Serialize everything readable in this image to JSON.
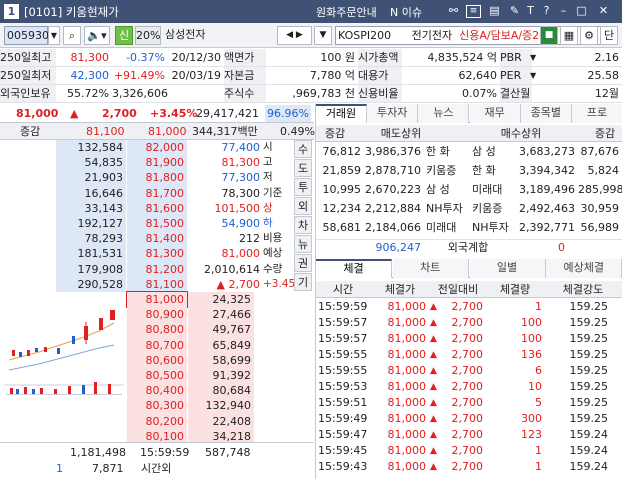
{
  "window": {
    "screen_no": "[0101]",
    "title": "키움현재가",
    "links": [
      "원화주문안내",
      "N 이슈"
    ]
  },
  "toolbar": {
    "code": "005930",
    "tag": "신",
    "pct": "20%",
    "stock_name": "삼성전자",
    "index": "KOSPI200",
    "sector": "전기전자",
    "credit": "신용A/담보A/증20",
    "right_btn": "단"
  },
  "info_rows": [
    {
      "a_label": "250일최고",
      "a_value": "81,300",
      "a_rate": "-0.37%",
      "a_date": "20/12/30",
      "b_label": "액면가",
      "b_value": "100 원",
      "c_label": "시가총액",
      "c_value": "4,835,524 억",
      "d_label": "PBR",
      "d_value": "2.16"
    },
    {
      "a_label": "250일최저",
      "a_value": "42,300",
      "a_rate": "+91.49%",
      "a_date": "20/03/19",
      "b_label": "자본금",
      "b_value": "7,780 억",
      "c_label": "대용가",
      "c_value": "62,640",
      "d_label": "PER",
      "d_value": "25.58"
    },
    {
      "a_label": "외국인보유",
      "a_value": "55.72%",
      "a_rate": "3,326,606(천)",
      "a_date": "",
      "b_label": "주식수",
      "b_value": ",969,783 천",
      "c_label": "신용비율",
      "c_value": "0.07%",
      "d_label": "결산월",
      "d_value": "12월"
    }
  ],
  "summary": {
    "price": "81,000",
    "arrow": "▲",
    "change": "2,700",
    "rate": "+3.45%",
    "volume": "29,417,421",
    "vol_ratio": "96.96%"
  },
  "ob_header": {
    "label": "증감",
    "price1": "81,100",
    "price2": "81,000",
    "amount": "344,317백만",
    "pct": "0.49%"
  },
  "ask_rows": [
    {
      "qty": "132,584",
      "price": "82,000"
    },
    {
      "qty": "54,835",
      "price": "81,900"
    },
    {
      "qty": "21,903",
      "price": "81,800"
    },
    {
      "qty": "16,646",
      "price": "81,700"
    },
    {
      "qty": "33,143",
      "price": "81,600"
    },
    {
      "qty": "192,127",
      "price": "81,500"
    },
    {
      "qty": "78,293",
      "price": "81,400"
    },
    {
      "qty": "181,531",
      "price": "81,300"
    },
    {
      "qty": "179,908",
      "price": "81,200"
    },
    {
      "qty": "290,528",
      "price": "81,100"
    }
  ],
  "bid_rows": [
    {
      "price": "81,000",
      "qty": "24,325"
    },
    {
      "price": "80,900",
      "qty": "27,466"
    },
    {
      "price": "80,800",
      "qty": "49,767"
    },
    {
      "price": "80,700",
      "qty": "65,849"
    },
    {
      "price": "80,600",
      "qty": "58,699"
    },
    {
      "price": "80,500",
      "qty": "91,392"
    },
    {
      "price": "80,400",
      "qty": "80,684"
    },
    {
      "price": "80,300",
      "qty": "132,940"
    },
    {
      "price": "80,200",
      "qty": "22,408"
    },
    {
      "price": "80,100",
      "qty": "34,218"
    }
  ],
  "mid_info": [
    {
      "v": "77,400",
      "l": "시"
    },
    {
      "v": "81,300",
      "l": "고"
    },
    {
      "v": "77,300",
      "l": "저"
    },
    {
      "v": "78,300",
      "l": "기준"
    },
    {
      "v": "101,500",
      "l": "상"
    },
    {
      "v": "54,900",
      "l": "하"
    },
    {
      "v": "212",
      "l": "비용"
    },
    {
      "v": "81,000",
      "l": "예상"
    },
    {
      "v": "2,010,614",
      "l": "수량"
    },
    {
      "v": "▲ 2,700",
      "l": "+3.45%"
    }
  ],
  "side_tabs": [
    "수",
    "도",
    "투",
    "외",
    "차",
    "뉴",
    "권",
    "기"
  ],
  "bottom": {
    "ask_total": "1,181,498",
    "time": "15:59:59",
    "bid_total": "587,748",
    "n1": "1",
    "n2": "7,871",
    "label": "시간외"
  },
  "top_tabs": [
    "거래원",
    "투자자",
    "뉴스",
    "재무",
    "종목별",
    "프로"
  ],
  "broker": {
    "col_hdr": [
      "증감",
      "매도상위",
      "매수상위",
      "증감"
    ],
    "rows": [
      {
        "s_chg": "76,812",
        "s_qty": "3,986,376",
        "s_name": "한 화",
        "b_name": "삼 성",
        "b_qty": "3,683,273",
        "b_chg": "87,676"
      },
      {
        "s_chg": "21,859",
        "s_qty": "2,878,710",
        "s_name": "키움증",
        "b_name": "한 화",
        "b_qty": "3,394,342",
        "b_chg": "5,824"
      },
      {
        "s_chg": "10,995",
        "s_qty": "2,670,223",
        "s_name": "삼 성",
        "b_name": "미래대",
        "b_qty": "3,189,496",
        "b_chg": "285,998"
      },
      {
        "s_chg": "12,234",
        "s_qty": "2,212,884",
        "s_name": "NH투자",
        "b_name": "키움증",
        "b_qty": "2,492,463",
        "b_chg": "30,959"
      },
      {
        "s_chg": "58,681",
        "s_qty": "2,184,066",
        "s_name": "미래대",
        "b_name": "NH투자",
        "b_qty": "2,392,771",
        "b_chg": "56,989"
      }
    ],
    "foreign": {
      "qty": "906,247",
      "label": "외국계합",
      "val": "0"
    }
  },
  "trade_tabs": [
    "체결",
    "차트",
    "일별",
    "예상체결"
  ],
  "trade_hdr": [
    "시간",
    "체결가",
    "전일대비",
    "체결량",
    "체결강도"
  ],
  "trades": [
    {
      "t": "15:59:59",
      "p": "81,000",
      "d": "2,700",
      "q": "1",
      "s": "159.25"
    },
    {
      "t": "15:59:57",
      "p": "81,000",
      "d": "2,700",
      "q": "100",
      "s": "159.25"
    },
    {
      "t": "15:59:57",
      "p": "81,000",
      "d": "2,700",
      "q": "100",
      "s": "159.25"
    },
    {
      "t": "15:59:55",
      "p": "81,000",
      "d": "2,700",
      "q": "136",
      "s": "159.25"
    },
    {
      "t": "15:59:55",
      "p": "81,000",
      "d": "2,700",
      "q": "6",
      "s": "159.25"
    },
    {
      "t": "15:59:53",
      "p": "81,000",
      "d": "2,700",
      "q": "10",
      "s": "159.25"
    },
    {
      "t": "15:59:51",
      "p": "81,000",
      "d": "2,700",
      "q": "5",
      "s": "159.25"
    },
    {
      "t": "15:59:49",
      "p": "81,000",
      "d": "2,700",
      "q": "300",
      "s": "159.25"
    },
    {
      "t": "15:59:47",
      "p": "81,000",
      "d": "2,700",
      "q": "123",
      "s": "159.24"
    },
    {
      "t": "15:59:45",
      "p": "81,000",
      "d": "2,700",
      "q": "1",
      "s": "159.24"
    },
    {
      "t": "15:59:43",
      "p": "81,000",
      "d": "2,700",
      "q": "1",
      "s": "159.24"
    }
  ],
  "colors": {
    "up": "#e02020",
    "down": "#1f5fd0",
    "title_bar": "#3f5276",
    "ask_bg": "#dde7f6",
    "bid_bg": "#fbe1e1"
  }
}
